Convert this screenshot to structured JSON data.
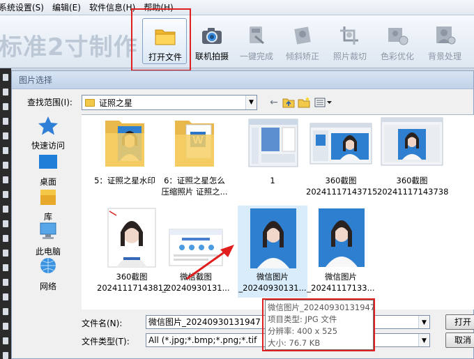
{
  "menu": [
    {
      "label": "系统设置(S)"
    },
    {
      "label": "编辑(E)"
    },
    {
      "label": "软件信息(H)"
    },
    {
      "label": "帮助(H)"
    }
  ],
  "app_title": "标准2寸制作",
  "toolbar": [
    {
      "id": "open",
      "label": "打开文件",
      "icon": "folder-icon",
      "enabled": true
    },
    {
      "id": "camera",
      "label": "联机拍摄",
      "icon": "camera-icon",
      "enabled": true
    },
    {
      "id": "oneclick",
      "label": "一键完成",
      "icon": "wand-icon",
      "enabled": false
    },
    {
      "id": "tilt",
      "label": "倾斜矫正",
      "icon": "rotate-icon",
      "enabled": false
    },
    {
      "id": "crop",
      "label": "照片裁切",
      "icon": "crop-icon",
      "enabled": false
    },
    {
      "id": "color",
      "label": "色彩优化",
      "icon": "palette-icon",
      "enabled": false
    },
    {
      "id": "bg",
      "label": "背景处理",
      "icon": "person-icon",
      "enabled": false
    }
  ],
  "dialog": {
    "title": "图片选择",
    "look_in_label": "查找范围(I):",
    "look_in_value": "证照之星",
    "places": [
      {
        "label": "快速访问",
        "icon": "star-icon"
      },
      {
        "label": "桌面",
        "icon": "desktop-icon"
      },
      {
        "label": "库",
        "icon": "library-icon"
      },
      {
        "label": "此电脑",
        "icon": "computer-icon"
      },
      {
        "label": "网络",
        "icon": "network-icon"
      }
    ],
    "files": [
      {
        "line1": "5：证照之星水印",
        "line2": "",
        "kind": "folder-photo"
      },
      {
        "line1": "6：证照之星怎么",
        "line2": "压缩照片 证照之...",
        "kind": "folder-word"
      },
      {
        "line1": "1",
        "line2": "",
        "kind": "screenshot"
      },
      {
        "line1": "360截图",
        "line2": "20241117143715",
        "kind": "screenshot-photo"
      },
      {
        "line1": "360截图",
        "line2": "20241117143738",
        "kind": "screenshot-photo2"
      },
      {
        "line1": "360截图",
        "line2": "20241117143812",
        "kind": "portrait-white"
      },
      {
        "line1": "微信截图",
        "line2": "_20240930131...",
        "kind": "webpage"
      },
      {
        "line1": "微信图片",
        "line2": "_20240930131...",
        "kind": "portrait-blue",
        "selected": true
      },
      {
        "line1": "微信图片",
        "line2": "_20241117133...",
        "kind": "portrait-blue"
      }
    ],
    "filename_label": "文件名(N):",
    "filename_value": "微信图片_20240930131947",
    "filetype_label": "文件类型(T):",
    "filetype_value": "All (*.jpg;*.bmp;*.png;*.tif",
    "open_button": "打开",
    "cancel_button": "取消"
  },
  "tooltip": {
    "name": "微信图片_20240930131947",
    "type": "项目类型: JPG 文件",
    "resolution": "分辨率: 400 x 525",
    "size": "大小: 76.7 KB"
  },
  "colors": {
    "highlight": "#e01e1e",
    "photo_bg": "#2e7fd0",
    "selection": "#d9ecfb"
  }
}
